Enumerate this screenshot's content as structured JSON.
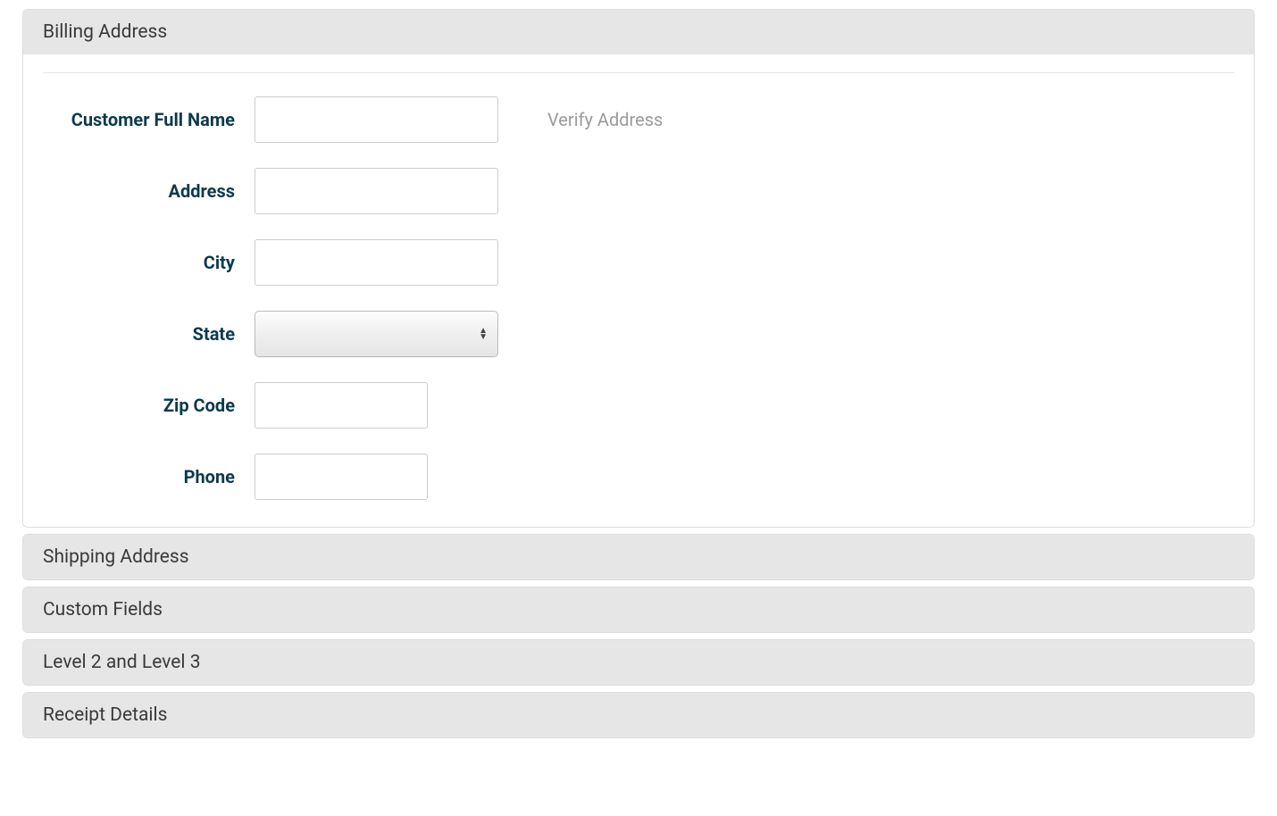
{
  "billing": {
    "header": "Billing Address",
    "verify_label": "Verify Address",
    "fields": {
      "name_label": "Customer Full Name",
      "name_value": "",
      "address_label": "Address",
      "address_value": "",
      "city_label": "City",
      "city_value": "",
      "state_label": "State",
      "state_value": "",
      "zip_label": "Zip Code",
      "zip_value": "",
      "phone_label": "Phone",
      "phone_value": ""
    }
  },
  "sections": {
    "shipping": "Shipping Address",
    "custom": "Custom Fields",
    "level": "Level 2 and Level 3",
    "receipt": "Receipt Details"
  }
}
